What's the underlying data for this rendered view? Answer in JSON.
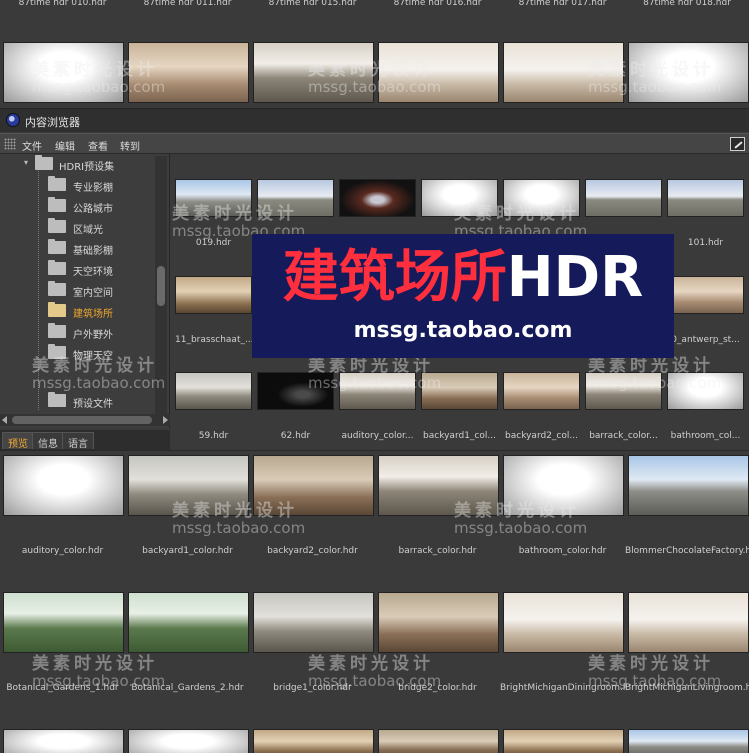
{
  "top_strip": {
    "labels": [
      "87time hdr 010.hdr",
      "87time hdr 011.hdr",
      "87time hdr 015.hdr",
      "87time hdr 016.hdr",
      "87time hdr 017.hdr",
      "87time hdr 018.hdr"
    ]
  },
  "panel": {
    "title": "内容浏览器"
  },
  "menu": {
    "items": [
      "文件",
      "编辑",
      "查看",
      "转到"
    ]
  },
  "tree": {
    "root": "HDRI预设集",
    "items": [
      "专业影棚",
      "公路城市",
      "区域光",
      "基础影棚",
      "天空环境",
      "室内空间",
      "建筑场所",
      "户外野外",
      "物理天空",
      "预设文件"
    ],
    "selected_index": 6
  },
  "tabs": {
    "items": [
      "预览",
      "信息",
      "语言"
    ],
    "active_index": 0
  },
  "content": {
    "labels": [
      "019.hdr",
      "101.hdr",
      "11_brasschaat_...",
      "0_antwerp_st...",
      "59.hdr",
      "62.hdr",
      "auditory_color...",
      "backyard1_col...",
      "backyard2_col...",
      "barrack_color...",
      "bathroom_col..."
    ]
  },
  "preview": {
    "labels": [
      "auditory_color.hdr",
      "backyard1_color.hdr",
      "backyard2_color.hdr",
      "barrack_color.hdr",
      "bathroom_color.hdr",
      "BlommerChocolateFactory.hdr",
      "Botanical_Gardens_1.hdr",
      "Botanical_Gardens_2.hdr",
      "bridge1_color.hdr",
      "bridge2_color.hdr",
      "BrightMichiganDiningroom.hdr",
      "BrightMichiganLivingroom.hdr"
    ]
  },
  "watermark": {
    "text": "美素时光设计",
    "url": "mssg.taobao.com"
  },
  "banner": {
    "title_cn": "建筑场所",
    "title_en": "HDR",
    "url": "mssg.taobao.com"
  },
  "colors": {
    "selected": "#f0a830",
    "banner_bg": "#151a5a",
    "banner_red": "#ff2f3d"
  }
}
